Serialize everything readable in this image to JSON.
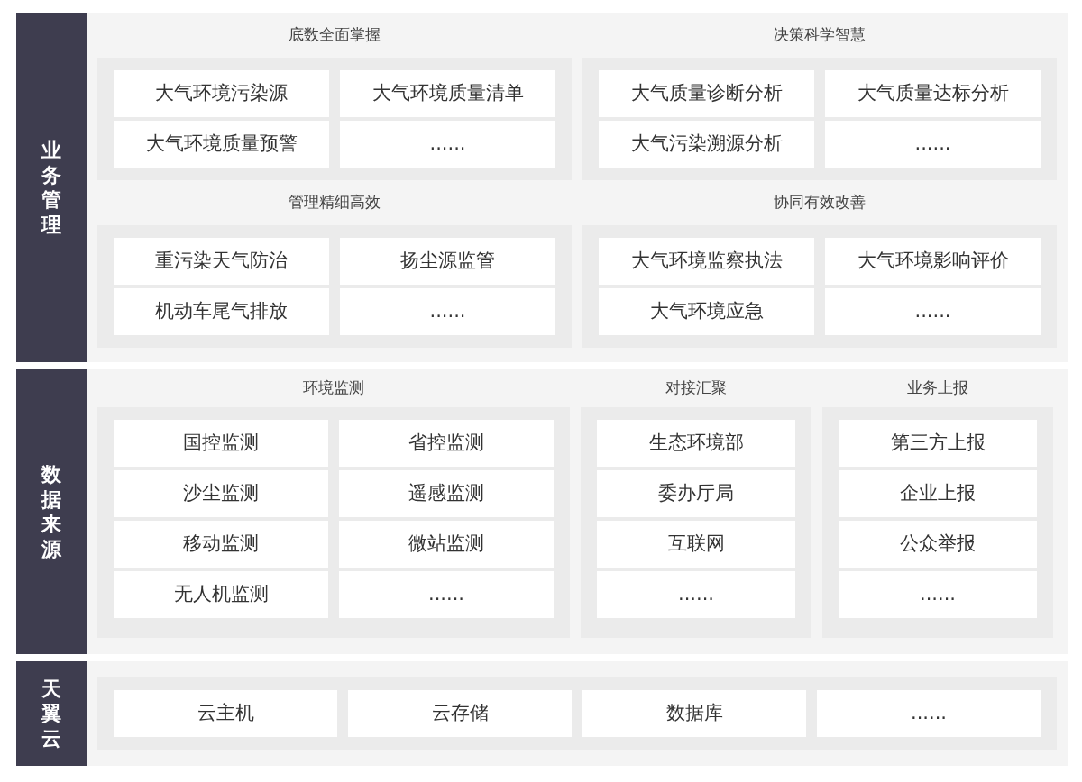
{
  "sections": [
    {
      "label": "业务管理",
      "kind": "quad",
      "groups": [
        {
          "title": "底数全面掌握",
          "items": [
            "大气环境污染源",
            "大气环境质量清单",
            "大气环境质量预警",
            "......"
          ]
        },
        {
          "title": "决策科学智慧",
          "items": [
            "大气质量诊断分析",
            "大气质量达标分析",
            "大气污染溯源分析",
            "......"
          ]
        },
        {
          "title": "管理精细高效",
          "items": [
            "重污染天气防治",
            "扬尘源监管",
            "机动车尾气排放",
            "......"
          ]
        },
        {
          "title": "协同有效改善",
          "items": [
            "大气环境监察执法",
            "大气环境影响评价",
            "大气环境应急",
            "......"
          ]
        }
      ]
    },
    {
      "label": "数据来源",
      "kind": "sources",
      "groups": [
        {
          "title": "环境监测",
          "items": [
            "国控监测",
            "省控监测",
            "沙尘监测",
            "遥感监测",
            "移动监测",
            "微站监测",
            "无人机监测",
            "......"
          ]
        },
        {
          "title": "对接汇聚",
          "items": [
            "生态环境部",
            "委办厅局",
            "互联网",
            "......"
          ]
        },
        {
          "title": "业务上报",
          "items": [
            "第三方上报",
            "企业上报",
            "公众举报",
            "......"
          ]
        }
      ]
    },
    {
      "label": "天翼云",
      "kind": "cloud",
      "groups": [
        {
          "items": [
            "云主机",
            "云存储",
            "数据库",
            "......"
          ]
        }
      ]
    }
  ]
}
